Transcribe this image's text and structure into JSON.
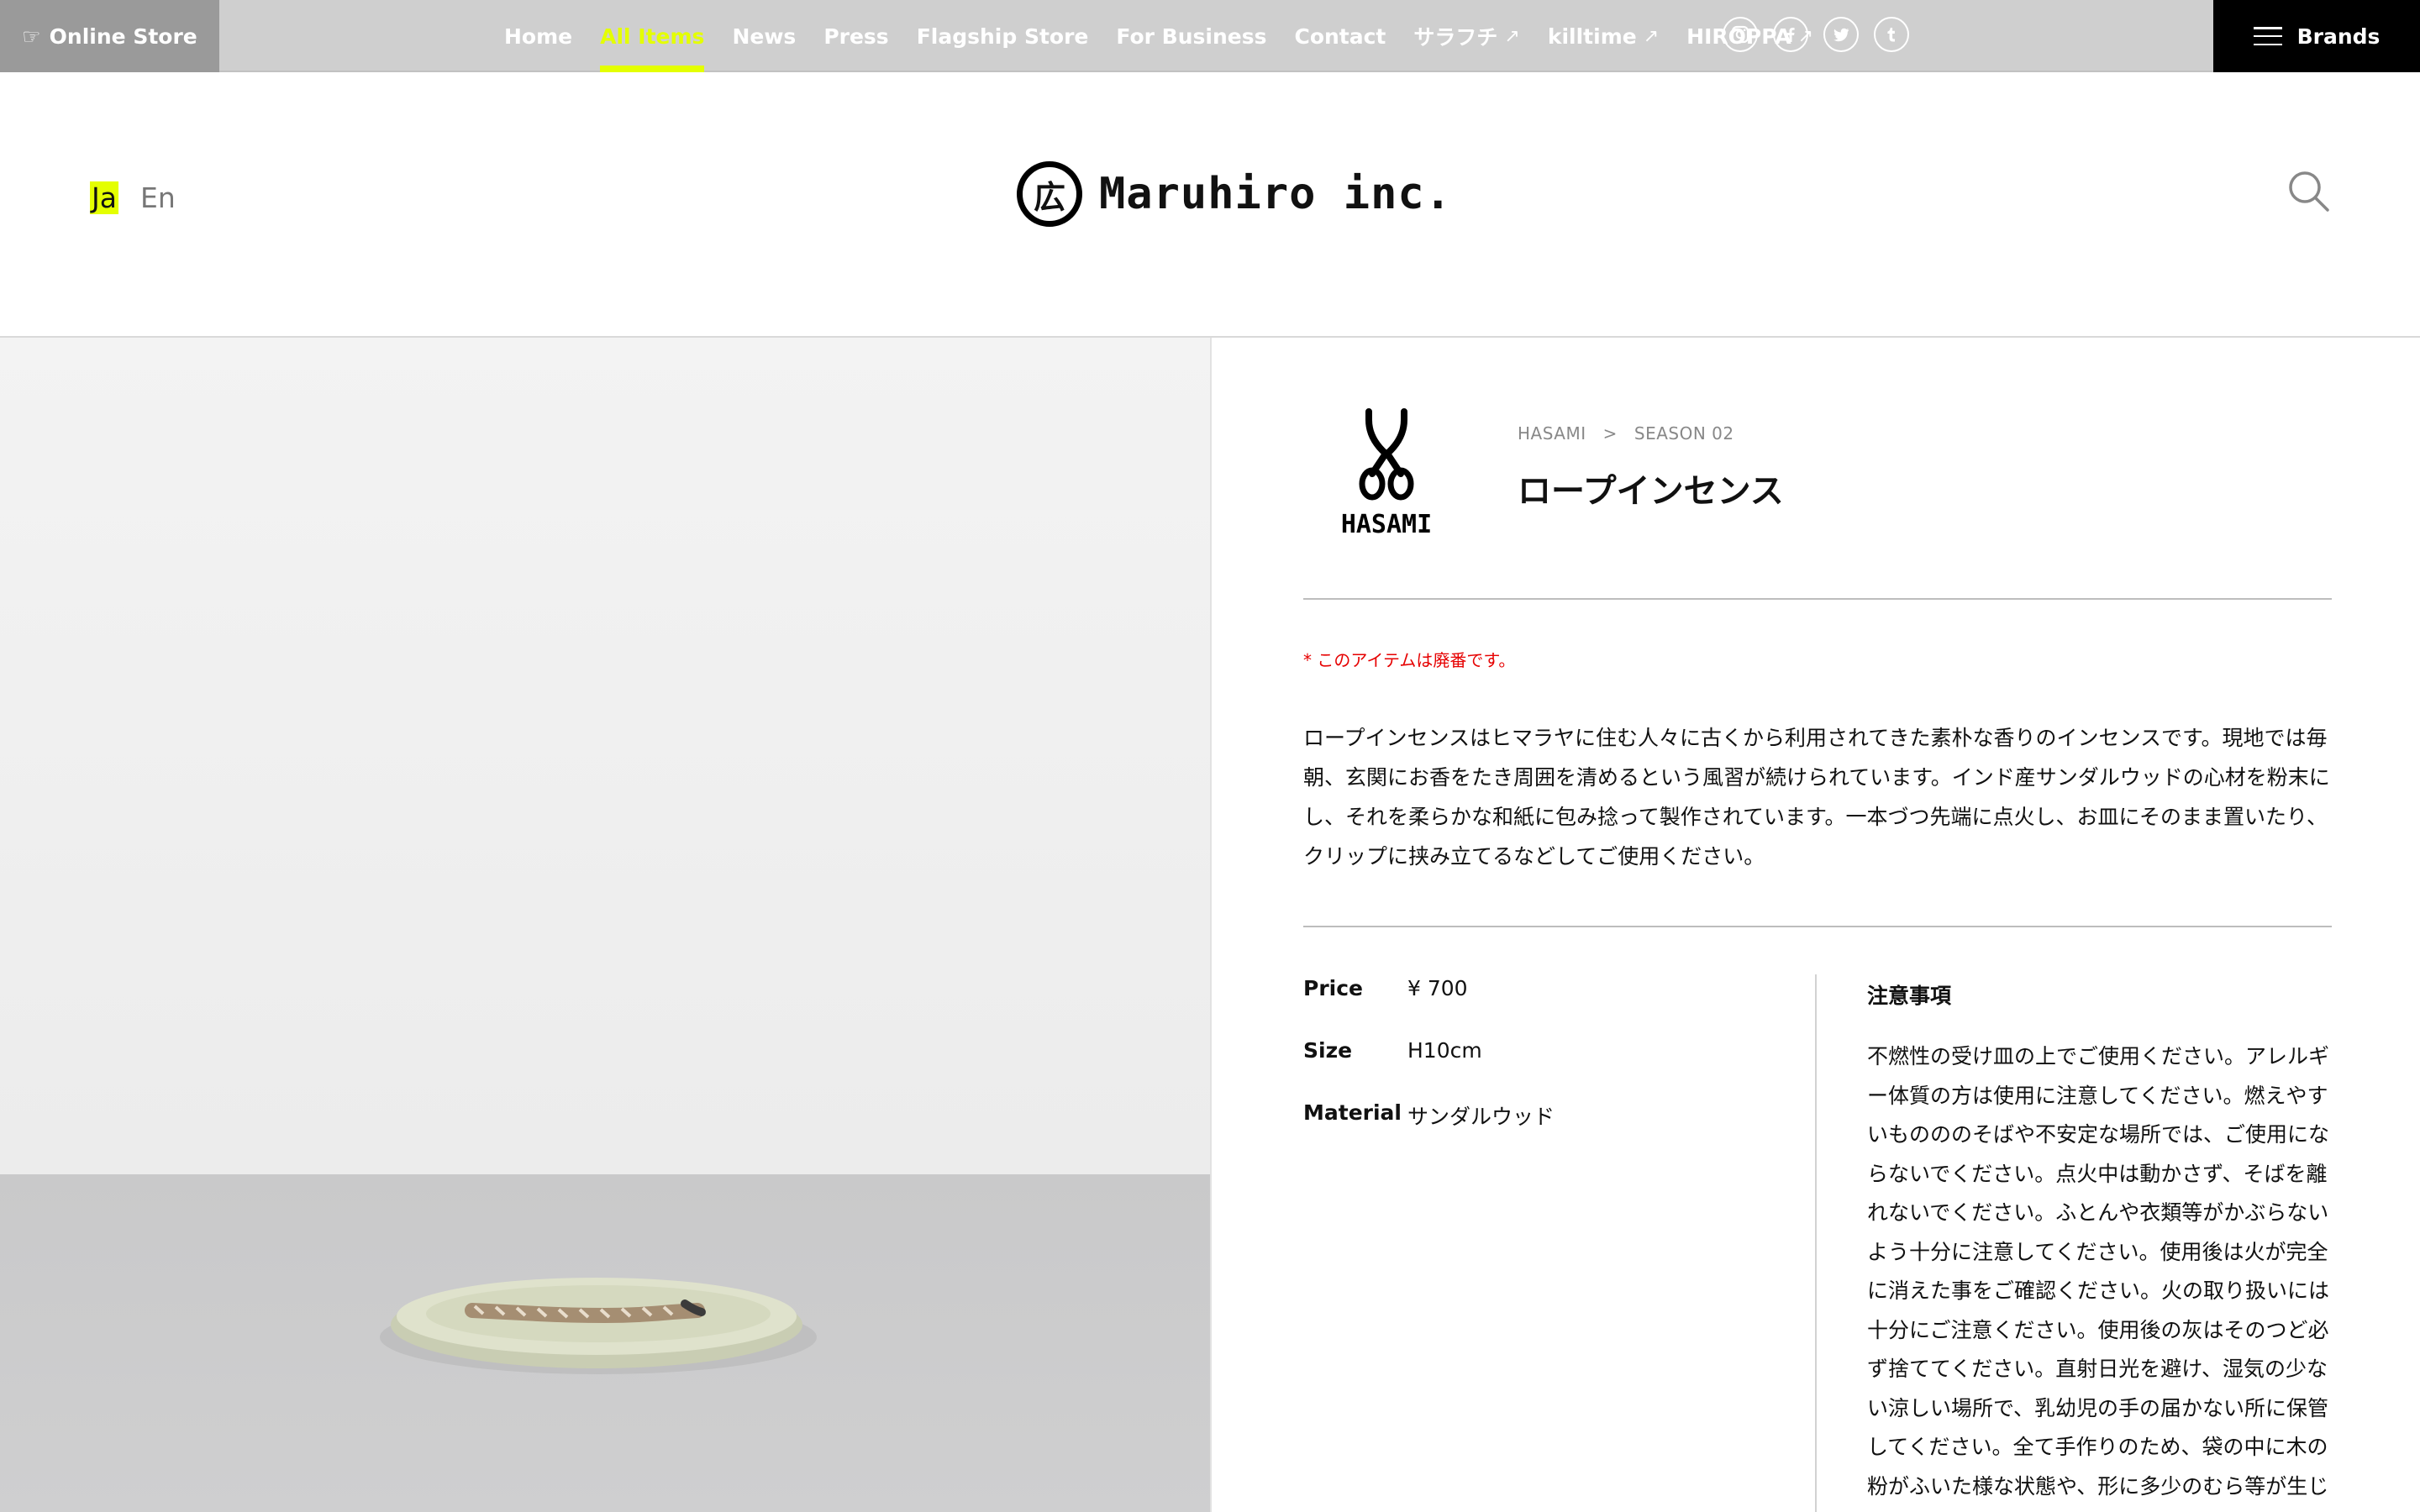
{
  "topbar": {
    "online_store": "Online Store",
    "nav": [
      {
        "label": "Home",
        "external": false,
        "active": false
      },
      {
        "label": "All Items",
        "external": false,
        "active": true
      },
      {
        "label": "News",
        "external": false,
        "active": false
      },
      {
        "label": "Press",
        "external": false,
        "active": false
      },
      {
        "label": "Flagship Store",
        "external": false,
        "active": false
      },
      {
        "label": "For Business",
        "external": false,
        "active": false
      },
      {
        "label": "Contact",
        "external": false,
        "active": false
      },
      {
        "label": "サラフチ",
        "external": true,
        "active": false
      },
      {
        "label": "killtime",
        "external": true,
        "active": false
      },
      {
        "label": "HIROPPA",
        "external": true,
        "active": false
      }
    ],
    "social": [
      "instagram-icon",
      "facebook-icon",
      "twitter-icon",
      "tumblr-icon"
    ],
    "brands_label": "Brands",
    "accent_color": "#e4ff00"
  },
  "header": {
    "lang_current": "Ja",
    "lang_other": "En",
    "logo_mark": "広",
    "logo_text": "Maruhiro inc."
  },
  "product": {
    "brand_logo_text": "HASAMI",
    "breadcrumb": [
      "HASAMI",
      ">",
      "SEASON 02"
    ],
    "title": "ロープインセンス",
    "notice": "* このアイテムは廃番です。",
    "description": "ロープインセンスはヒマラヤに住む人々に古くから利用されてきた素朴な香りのインセンスです。現地では毎朝、玄関にお香をたき周囲を清めるという風習が続けられています。インド産サンダルウッドの心材を粉末にし、それを柔らかな和紙に包み捻って製作されています。一本づつ先端に点火し、お皿にそのまま置いたり、クリップに挟み立てるなどしてご使用ください。",
    "specs": [
      {
        "label": "Price",
        "value": "¥ 700"
      },
      {
        "label": "Size",
        "value": "H10cm"
      },
      {
        "label": "Material",
        "value": "サンダルウッド"
      }
    ],
    "caution_title": "注意事項",
    "caution_body": "不燃性の受け皿の上でご使用ください。アレルギー体質の方は使用に注意してください。燃えやすいものののそばや不安定な場所では、ご使用にならないでください。点火中は動かさず、そばを離れないでください。ふとんや衣類等がかぶらないよう十分に注意してください。使用後は火が完全に消えた事をご確認ください。火の取り扱いには十分にご注意ください。使用後の灰はそのつど必ず捨ててください。直射日光を避け、湿気の少ない涼しい場所で、乳幼児の手の届かない所に保管してください。全て手作りのため、袋の中に木の粉がふいた様な状態や、形に多少のむら等が生じる場合がありますが、品質に問題はありませ",
    "notice_color": "#e60000"
  }
}
